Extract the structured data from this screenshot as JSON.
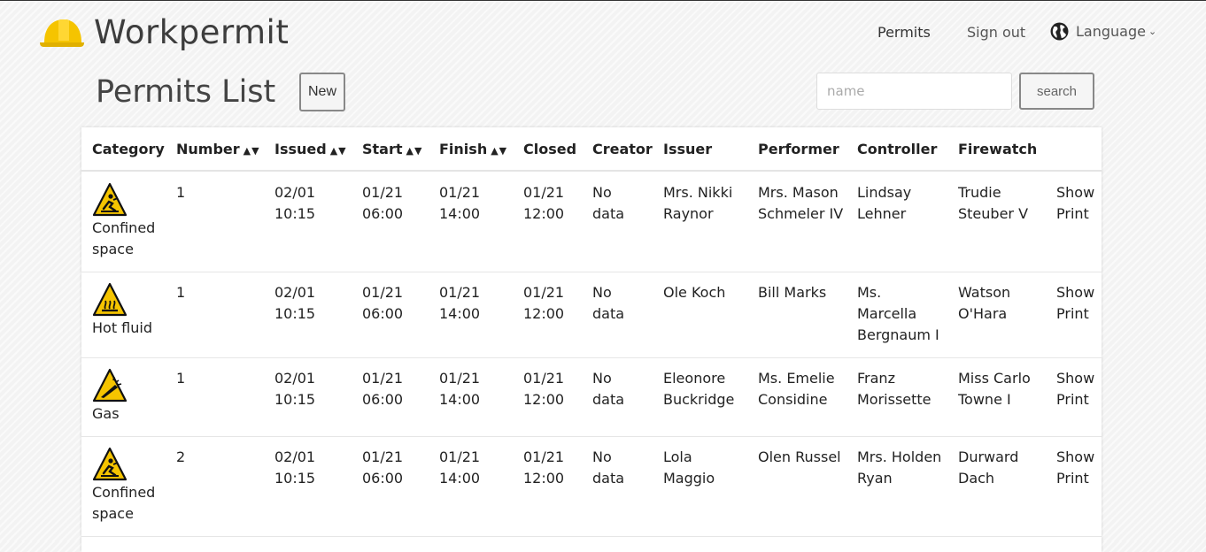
{
  "brand": {
    "title": "Workpermit",
    "accent": "#f5c400"
  },
  "nav": {
    "permits": "Permits",
    "signout": "Sign out",
    "language": "Language"
  },
  "page": {
    "title": "Permits List",
    "new_label": "New"
  },
  "search": {
    "placeholder": "name",
    "button_label": "search"
  },
  "table": {
    "headers": {
      "category": "Category",
      "number": "Number",
      "issued": "Issued",
      "start": "Start",
      "finish": "Finish",
      "closed": "Closed",
      "creator": "Creator",
      "issuer": "Issuer",
      "performer": "Performer",
      "controller": "Controller",
      "firewatch": "Firewatch",
      "sort_glyph": "▲▼"
    },
    "rows": [
      {
        "icon": "confined-space-icon",
        "category": [
          "Confined",
          "space"
        ],
        "number": "1",
        "issued": [
          "02/01",
          "10:15"
        ],
        "start": [
          "01/21",
          "06:00"
        ],
        "finish": [
          "01/21",
          "14:00"
        ],
        "closed": [
          "01/21",
          "12:00"
        ],
        "creator": [
          "No",
          "data"
        ],
        "issuer": [
          "Mrs. Nikki",
          "Raynor"
        ],
        "performer": [
          "Mrs. Mason",
          "Schmeler IV"
        ],
        "controller": [
          "Lindsay",
          "Lehner"
        ],
        "firewatch": [
          "Trudie",
          "Steuber V"
        ],
        "show": "Show",
        "print": "Print"
      },
      {
        "icon": "hot-fluid-icon",
        "category": [
          "Hot fluid"
        ],
        "number": "1",
        "issued": [
          "02/01",
          "10:15"
        ],
        "start": [
          "01/21",
          "06:00"
        ],
        "finish": [
          "01/21",
          "14:00"
        ],
        "closed": [
          "01/21",
          "12:00"
        ],
        "creator": [
          "No",
          "data"
        ],
        "issuer": [
          "Ole Koch"
        ],
        "performer": [
          "Bill Marks"
        ],
        "controller": [
          "Ms.",
          "Marcella",
          "Bergnaum I"
        ],
        "firewatch": [
          "Watson",
          "O'Hara"
        ],
        "show": "Show",
        "print": "Print"
      },
      {
        "icon": "gas-icon",
        "category": [
          "Gas"
        ],
        "number": "1",
        "issued": [
          "02/01",
          "10:15"
        ],
        "start": [
          "01/21",
          "06:00"
        ],
        "finish": [
          "01/21",
          "14:00"
        ],
        "closed": [
          "01/21",
          "12:00"
        ],
        "creator": [
          "No",
          "data"
        ],
        "issuer": [
          "Eleonore",
          "Buckridge"
        ],
        "performer": [
          "Ms. Emelie",
          "Considine"
        ],
        "controller": [
          "Franz",
          "Morissette"
        ],
        "firewatch": [
          "Miss Carlo",
          "Towne I"
        ],
        "show": "Show",
        "print": "Print"
      },
      {
        "icon": "confined-space-icon",
        "category": [
          "Confined",
          "space"
        ],
        "number": "2",
        "issued": [
          "02/01",
          "10:15"
        ],
        "start": [
          "01/21",
          "06:00"
        ],
        "finish": [
          "01/21",
          "14:00"
        ],
        "closed": [
          "01/21",
          "12:00"
        ],
        "creator": [
          "No",
          "data"
        ],
        "issuer": [
          "Lola",
          "Maggio"
        ],
        "performer": [
          "Olen Russel"
        ],
        "controller": [
          "Mrs. Holden",
          "Ryan"
        ],
        "firewatch": [
          "Durward",
          "Dach"
        ],
        "show": "Show",
        "print": "Print"
      }
    ]
  }
}
